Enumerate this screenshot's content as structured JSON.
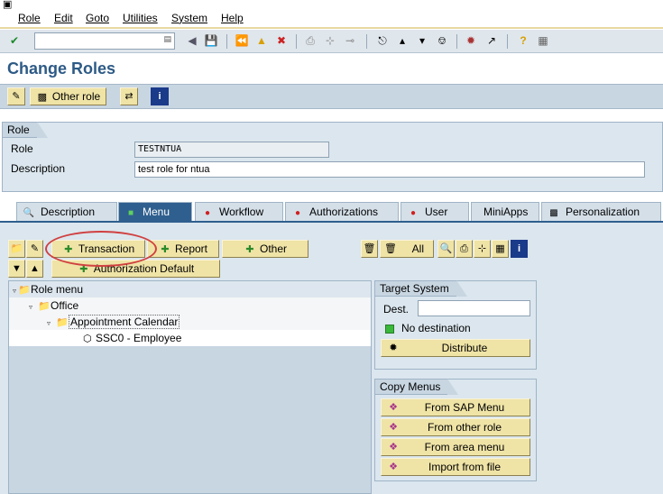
{
  "menubar": {
    "items": [
      "Role",
      "Edit",
      "Goto",
      "Utilities",
      "System",
      "Help"
    ]
  },
  "systoolbar": {
    "command_value": ""
  },
  "page": {
    "title": "Change Roles"
  },
  "apptoolbar": {
    "other_role_label": "Other role"
  },
  "role_group": {
    "title": "Role",
    "role_label": "Role",
    "role_value": "TESTNTUA",
    "description_label": "Description",
    "description_value": "test role for ntua"
  },
  "tabs": [
    {
      "label": "Description"
    },
    {
      "label": "Menu"
    },
    {
      "label": "Workflow"
    },
    {
      "label": "Authorizations"
    },
    {
      "label": "User"
    },
    {
      "label": "MiniApps"
    },
    {
      "label": "Personalization"
    }
  ],
  "menu_tab": {
    "transaction_label": "Transaction",
    "report_label": "Report",
    "other_label": "Other",
    "auth_default_label": "Authorization Default",
    "all_label": "All"
  },
  "tree": {
    "items": [
      {
        "label": "Role menu"
      },
      {
        "label": "Office"
      },
      {
        "label": "Appointment Calendar"
      },
      {
        "label": "SSC0 - Employee"
      }
    ]
  },
  "target_system": {
    "title": "Target System",
    "dest_label": "Dest.",
    "dest_value": "",
    "status_text": "No destination",
    "distribute_label": "Distribute"
  },
  "copy_menus": {
    "title": "Copy Menus",
    "buttons": [
      {
        "label": "From SAP Menu"
      },
      {
        "label": "From other role"
      },
      {
        "label": "From area menu"
      },
      {
        "label": "Import from file"
      }
    ]
  },
  "colors": {
    "accent": "#2f5f8e",
    "button": "#efe3a6",
    "background": "#dbe6ee",
    "highlight": "#d04040"
  }
}
